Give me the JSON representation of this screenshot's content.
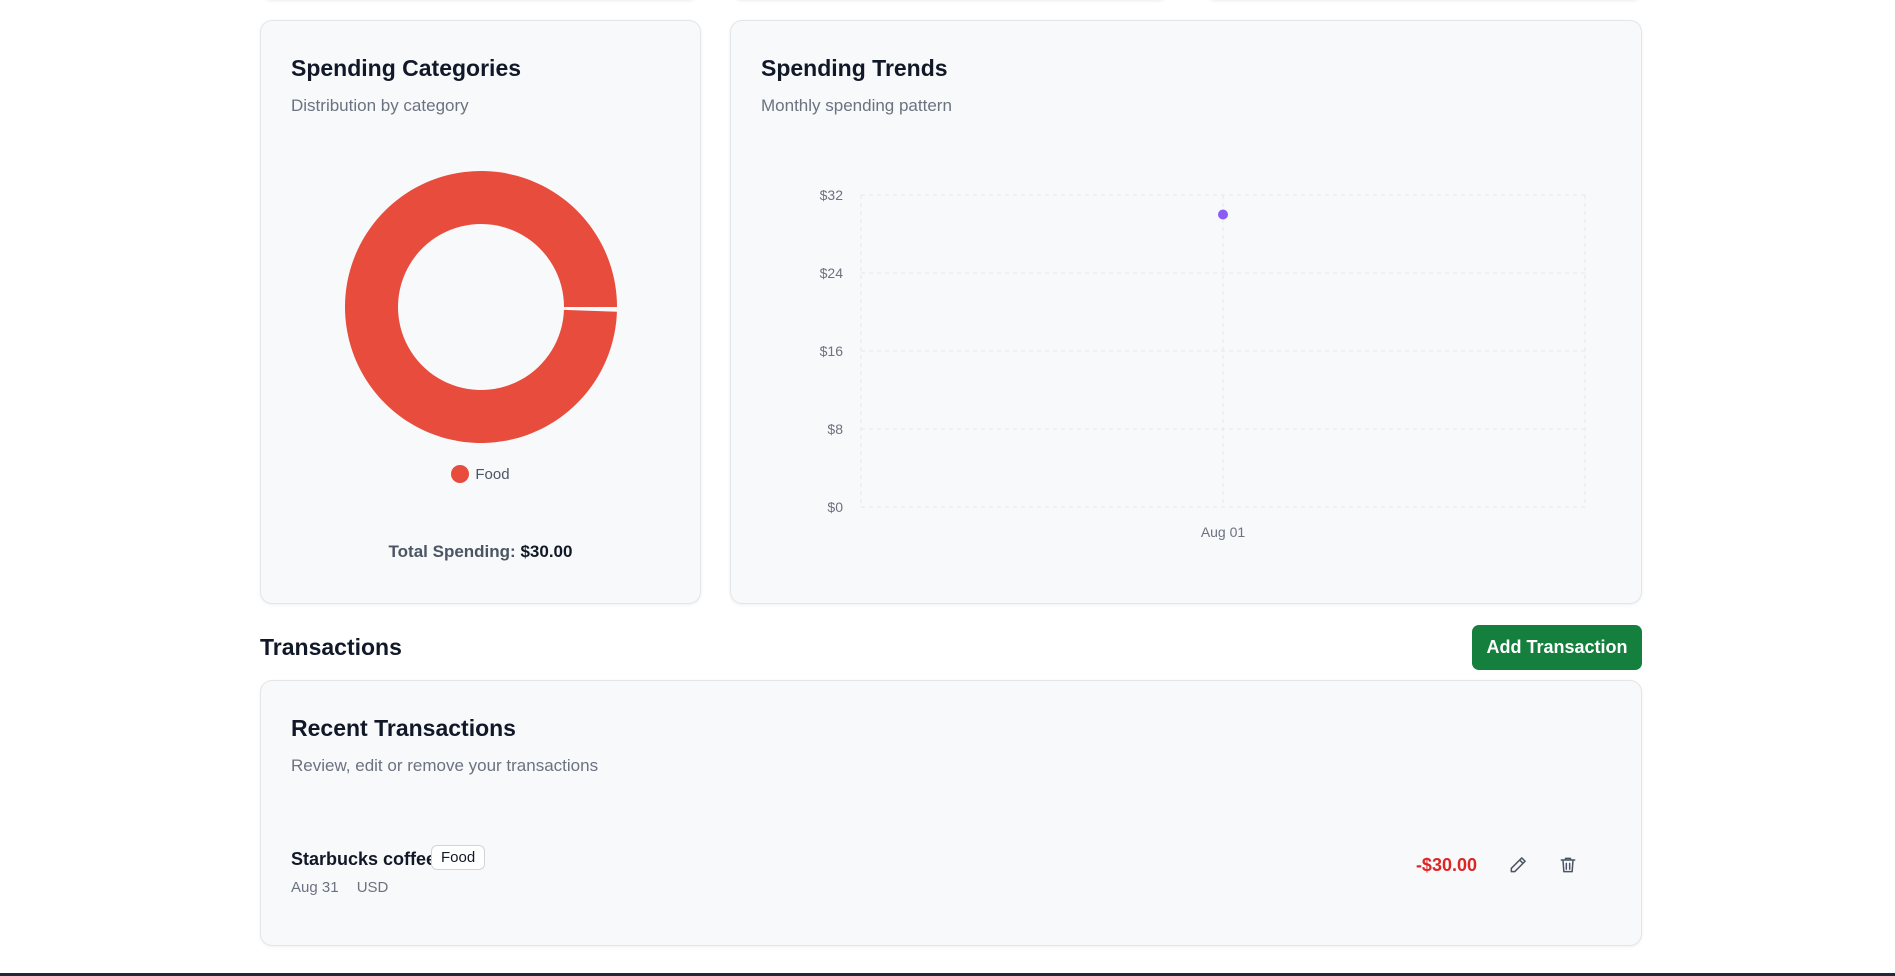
{
  "categories_card": {
    "title": "Spending Categories",
    "subtitle": "Distribution by category",
    "legend": [
      {
        "label": "Food",
        "color": "#e74c3c"
      }
    ],
    "total_label": "Total Spending:",
    "total_value": "$30.00"
  },
  "trends_card": {
    "title": "Spending Trends",
    "subtitle": "Monthly spending pattern"
  },
  "chart_data": [
    {
      "type": "pie",
      "variant": "donut",
      "slices": [
        {
          "label": "Food",
          "value": 30,
          "color": "#e74c3c"
        }
      ]
    },
    {
      "type": "scatter",
      "x": [
        "Aug 01"
      ],
      "y": [
        30
      ],
      "point_color": "#8b5cf6",
      "yticks": [
        "$0",
        "$8",
        "$16",
        "$24",
        "$32"
      ],
      "ytick_values": [
        0,
        8,
        16,
        24,
        32
      ],
      "ylim": [
        0,
        32
      ],
      "grid": true
    }
  ],
  "transactions": {
    "section_title": "Transactions",
    "add_button": "Add Transaction",
    "card_title": "Recent Transactions",
    "card_subtitle": "Review, edit or remove your transactions",
    "items": [
      {
        "name": "Starbucks coffee",
        "category": "Food",
        "date": "Aug 31",
        "currency": "USD",
        "amount": "-$30.00",
        "edit_icon": "pencil-icon",
        "delete_icon": "trash-icon"
      }
    ]
  },
  "colors": {
    "accent_green": "#15803d",
    "negative_red": "#dc2626",
    "food_red": "#e74c3c",
    "trend_purple": "#8b5cf6"
  }
}
